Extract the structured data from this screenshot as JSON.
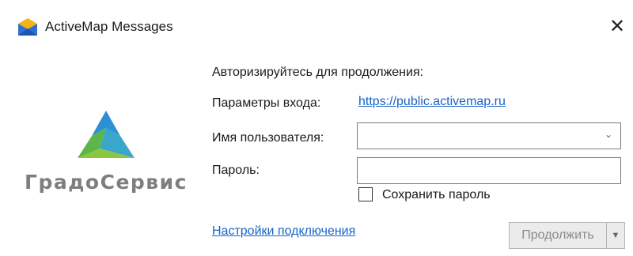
{
  "window": {
    "title": "ActiveMap Messages",
    "app_icon": "envelope-icon",
    "close_glyph": "✕"
  },
  "logo": {
    "text": "ГрадоСервис",
    "icon": "gradoservis-logo-icon"
  },
  "form": {
    "heading": "Авторизируйтесь для продолжения:",
    "server_label": "Параметры входа:",
    "server_url": "https://public.activemap.ru",
    "username_label": "Имя пользователя:",
    "username_value": "",
    "password_label": "Пароль:",
    "password_value": "",
    "save_password_label": "Сохранить пароль",
    "save_password_checked": false,
    "connection_settings_link": "Настройки подключения",
    "continue_label": "Продолжить",
    "continue_enabled": false
  },
  "colors": {
    "link": "#1763c8",
    "logo_text": "#7e7e7e",
    "logo_blue": "#2d8fd6",
    "logo_green": "#5cb64a"
  }
}
